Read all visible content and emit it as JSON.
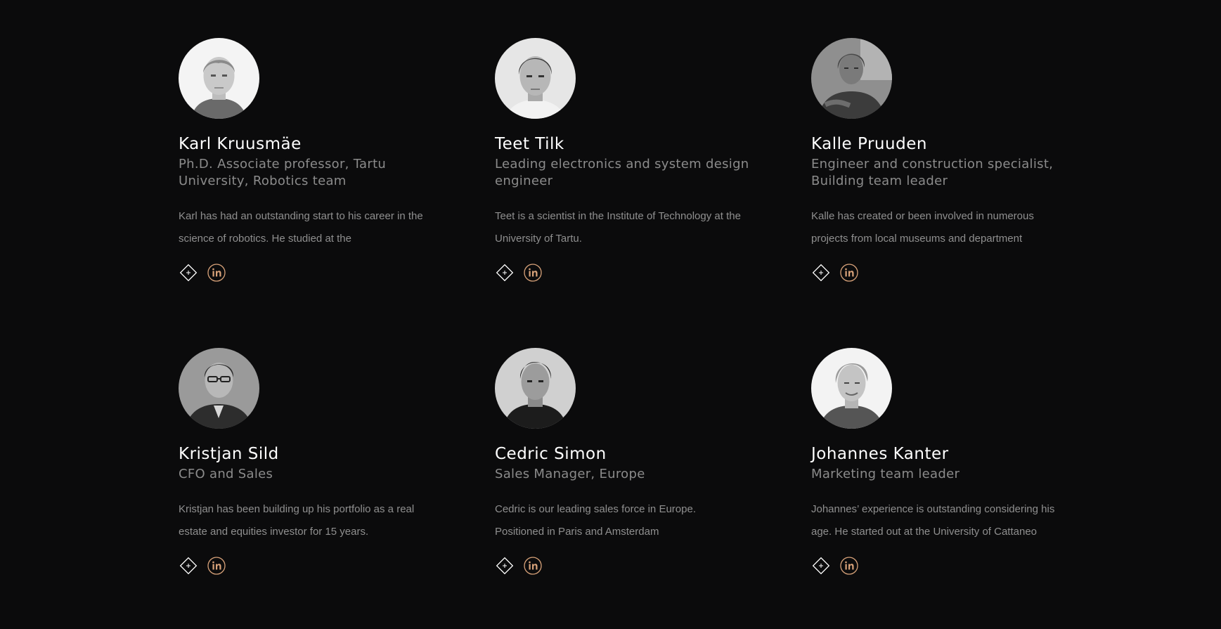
{
  "accent_color": "#d9a37a",
  "members": [
    {
      "name": "Karl Kruusmäe",
      "role": "Ph.D. Associate professor, Tartu University, Robotics team",
      "bio": "Karl has had an outstanding start to his career in the science of robotics. He studied at the",
      "avatar": "portrait-photo",
      "more_icon": "diamond-plus-icon",
      "social_icon": "linkedin-icon"
    },
    {
      "name": "Teet Tilk",
      "role": "Leading electronics and system design engineer",
      "bio": "Teet is a scientist in the Institute of Technology at the University of Tartu.",
      "avatar": "portrait-photo",
      "more_icon": "diamond-plus-icon",
      "social_icon": "linkedin-icon"
    },
    {
      "name": "Kalle Pruuden",
      "role": "Engineer and construction specialist, Building team leader",
      "bio": "Kalle has created or been involved in numerous projects from local museums and department",
      "avatar": "portrait-photo",
      "more_icon": "diamond-plus-icon",
      "social_icon": "linkedin-icon"
    },
    {
      "name": "Kristjan Sild",
      "role": "CFO and Sales",
      "bio": "Kristjan has been building up his portfolio as a real estate and equities investor for 15 years.",
      "avatar": "portrait-photo",
      "more_icon": "diamond-plus-icon",
      "social_icon": "linkedin-icon"
    },
    {
      "name": "Cedric Simon",
      "role": "Sales Manager, Europe",
      "bio": "Cedric is our leading sales force in Europe. Positioned in Paris and Amsterdam",
      "avatar": "portrait-photo",
      "more_icon": "diamond-plus-icon",
      "social_icon": "linkedin-icon"
    },
    {
      "name": "Johannes Kanter",
      "role": "Marketing team leader",
      "bio": "Johannes’ experience is outstanding considering his age. He started out at the University of Cattaneo",
      "avatar": "portrait-photo",
      "more_icon": "diamond-plus-icon",
      "social_icon": "linkedin-icon"
    }
  ]
}
